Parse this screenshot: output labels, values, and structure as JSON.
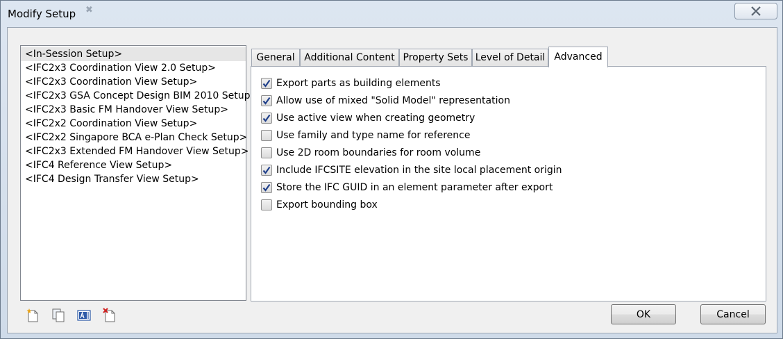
{
  "window": {
    "title": "Modify Setup",
    "title_glyph": "✖"
  },
  "setups": [
    {
      "label": "<In-Session Setup>",
      "selected": true
    },
    {
      "label": "<IFC2x3 Coordination View 2.0 Setup>",
      "selected": false
    },
    {
      "label": "<IFC2x3 Coordination View Setup>",
      "selected": false
    },
    {
      "label": "<IFC2x3 GSA Concept Design BIM 2010 Setup>",
      "selected": false
    },
    {
      "label": "<IFC2x3 Basic FM Handover View Setup>",
      "selected": false
    },
    {
      "label": "<IFC2x2 Coordination View Setup>",
      "selected": false
    },
    {
      "label": "<IFC2x2 Singapore BCA e-Plan Check Setup>",
      "selected": false
    },
    {
      "label": "<IFC2x3 Extended FM Handover View Setup>",
      "selected": false
    },
    {
      "label": "<IFC4 Reference View Setup>",
      "selected": false
    },
    {
      "label": "<IFC4 Design Transfer View Setup>",
      "selected": false
    }
  ],
  "tabs": [
    {
      "label": "General",
      "active": false
    },
    {
      "label": "Additional Content",
      "active": false
    },
    {
      "label": "Property Sets",
      "active": false
    },
    {
      "label": "Level of Detail",
      "active": false
    },
    {
      "label": "Advanced",
      "active": true
    }
  ],
  "options": [
    {
      "label": "Export parts as building elements",
      "checked": true
    },
    {
      "label": "Allow use of mixed \"Solid Model\" representation",
      "checked": true
    },
    {
      "label": "Use active view when creating geometry",
      "checked": true
    },
    {
      "label": "Use family and type name for reference",
      "checked": false
    },
    {
      "label": "Use 2D room boundaries for room volume",
      "checked": false
    },
    {
      "label": "Include IFCSITE elevation in the site local placement origin",
      "checked": true
    },
    {
      "label": "Store the IFC GUID in an element parameter after export",
      "checked": true
    },
    {
      "label": "Export bounding box",
      "checked": false
    }
  ],
  "toolbar": [
    {
      "icon": "new-setup-icon"
    },
    {
      "icon": "duplicate-setup-icon"
    },
    {
      "icon": "rename-setup-icon"
    },
    {
      "icon": "delete-setup-icon"
    }
  ],
  "buttons": {
    "ok": "OK",
    "cancel": "Cancel"
  },
  "colors": {
    "check_mark": "#1f3f8a",
    "delete_x": "#d02020",
    "new_star": "#e8a010"
  }
}
